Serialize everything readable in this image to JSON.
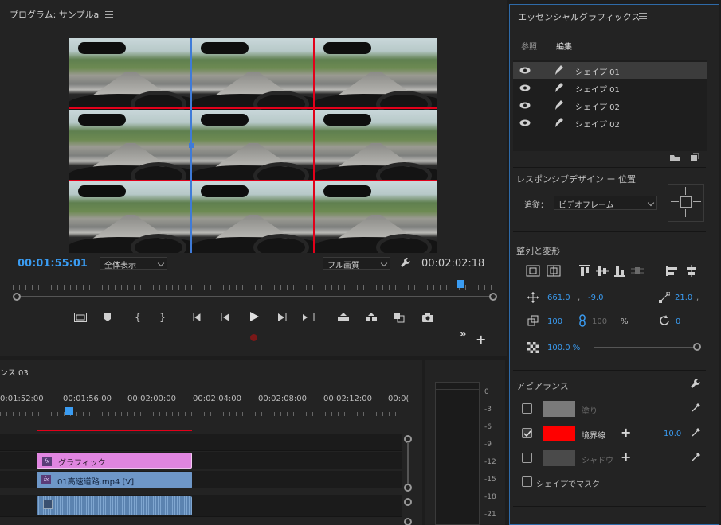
{
  "program": {
    "title": "プログラム: サンプルa",
    "timecode_current": "00:01:55:01",
    "timecode_duration": "00:02:02:18",
    "zoom": "全体表示",
    "quality": "フル画質"
  },
  "timeline": {
    "title": "ンス 03",
    "ruler_labels": [
      "0:01:52:00",
      "00:01:56:00",
      "00:02:00:00",
      "00:02:04:00",
      "00:02:08:00",
      "00:02:12:00",
      "00:0("
    ],
    "clips": {
      "graphic": "グラフィック",
      "video": "01高速道路.mp4 [V]",
      "fx": "fx"
    },
    "meter_scale": [
      "0",
      "-3",
      "-6",
      "-9",
      "-12",
      "-15",
      "-18",
      "-21"
    ]
  },
  "essential_graphics": {
    "title": "エッセンシャルグラフィックス",
    "tabs": [
      "参照",
      "編集"
    ],
    "active_tab": "編集",
    "layers": [
      "シェイプ 01",
      "シェイプ 01",
      "シェイプ 02",
      "シェイプ 02"
    ],
    "responsive": {
      "heading": "レスポンシブデザイン ー 位置",
      "pin_label": "追従：",
      "pin_value": "ビデオフレーム"
    },
    "align": {
      "heading": "整列と変形",
      "pos_x": "661.0",
      "pos_y": "-9.0",
      "anchor": "21.0",
      "scale": "100",
      "scale_h": "100",
      "percent": "%",
      "rotation": "0",
      "opacity": "100.0 %",
      "opacity_fraction": 1.0
    },
    "appearance": {
      "heading": "アピアランス",
      "fill_label": "塗り",
      "stroke_label": "境界線",
      "stroke_width": "10.0",
      "shadow_label": "シャドウ",
      "mask_label": "シェイプでマスク",
      "fill_checked": false,
      "stroke_checked": true,
      "shadow_checked": false,
      "fill_color": "#7a7a7a",
      "stroke_color": "#ff0000",
      "shadow_color": "#4a4a4a"
    }
  },
  "colors": {
    "accent_blue": "#3a9cf2",
    "guide_red": "#e2001a",
    "graphic_clip": "#e085e0",
    "video_clip": "#6e97c8",
    "audio_clip": "#5b83b0"
  }
}
